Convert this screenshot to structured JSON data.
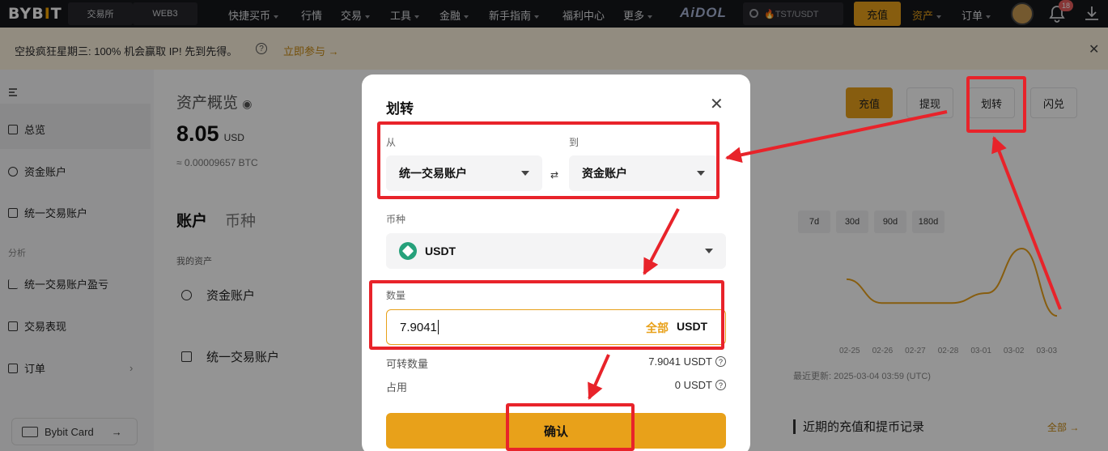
{
  "topnav": {
    "logo": "BYB",
    "logo_dot": "I",
    "logo_end": "T",
    "tabs": [
      "交易所",
      "WEB3"
    ],
    "items": [
      "快捷买币",
      "行情",
      "交易",
      "工具",
      "金融",
      "新手指南",
      "福利中心",
      "更多"
    ],
    "aidol": "AiDOL",
    "search_placeholder": "🔥TST/USDT",
    "deposit": "充值",
    "assets": "资产",
    "orders": "订单",
    "badge": "18"
  },
  "announcement": {
    "text": "空投疯狂星期三: 100% 机会赢取 IP! 先到先得。",
    "join": "立即参与 →"
  },
  "sidebar": {
    "items": [
      "总览",
      "资金账户",
      "统一交易账户"
    ],
    "section": "分析",
    "analysis_items": [
      "统一交易账户盈亏",
      "交易表现",
      "订单"
    ],
    "card": "Bybit Card"
  },
  "main": {
    "title": "资产概览",
    "amount": "8.05",
    "currency": "USD",
    "btc": "≈ 0.00009657 BTC",
    "tab_account": "账户",
    "tab_coin": "币种",
    "my_assets": "我的资产",
    "acct1": "资金账户",
    "acct2": "统一交易账户",
    "actions": [
      "充值",
      "提现",
      "划转",
      "闪兑"
    ],
    "ranges": [
      "7d",
      "30d",
      "90d",
      "180d"
    ],
    "dates": [
      "02-25",
      "02-26",
      "02-27",
      "02-28",
      "03-01",
      "03-02",
      "03-03"
    ],
    "updated": "最近更新: 2025-03-04 03:59 (UTC)",
    "recent": "近期的充值和提币记录",
    "all": "全部 →"
  },
  "chart_data": {
    "type": "line",
    "x": [
      "02-25",
      "02-26",
      "02-27",
      "02-28",
      "03-01",
      "03-02",
      "03-03"
    ],
    "series": [
      {
        "values": [
          5.0,
          2.6,
          2.6,
          2.6,
          3.6,
          8.1,
          1.3
        ]
      }
    ]
  },
  "modal": {
    "title": "划转",
    "from_label": "从",
    "to_label": "到",
    "from_value": "统一交易账户",
    "to_value": "资金账户",
    "coin_label": "币种",
    "coin_value": "USDT",
    "qty_label": "数量",
    "qty_value": "7.9041",
    "qty_all": "全部",
    "qty_unit": "USDT",
    "available_label": "可转数量",
    "available_value": "7.9041 USDT",
    "occupied_label": "占用",
    "occupied_value": "0 USDT",
    "confirm": "确认"
  },
  "colors": {
    "accent": "#e8a11a",
    "annotation_red": "#e8232a"
  }
}
